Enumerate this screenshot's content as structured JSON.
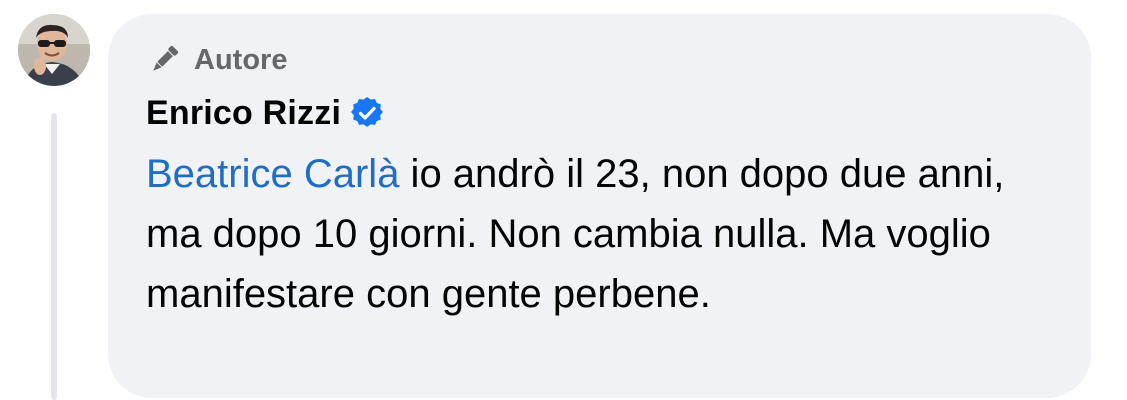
{
  "comment": {
    "author_badge": "Autore",
    "author_name": "Enrico Rizzi",
    "mention": "Beatrice Carlà",
    "text": " io andrò il 23, non dopo due anni, ma dopo 10 giorni. Non cambia nulla. Ma voglio manifestare con gente perbene."
  },
  "icons": {
    "author_badge": "pen-icon",
    "verified": "verified-badge-icon",
    "avatar": "profile-avatar"
  },
  "colors": {
    "bubble": "#f0f2f5",
    "mention": "#1f6ec4",
    "verified": "#1877f2",
    "muted": "#65676b",
    "text": "#050505"
  }
}
